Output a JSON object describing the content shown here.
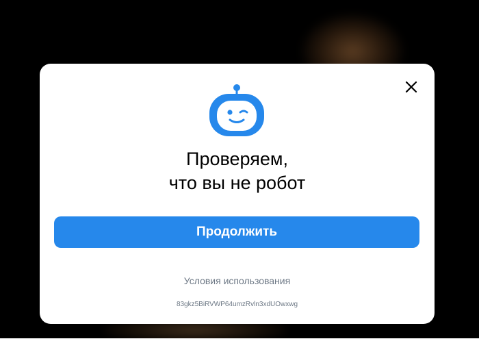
{
  "dialog": {
    "title_line1": "Проверяем,",
    "title_line2": "что вы не робот",
    "continue_label": "Продолжить",
    "terms_label": "Условия использования",
    "token": "83gkz5BiRVWP64umzRvln3xdUOwxwg",
    "close_icon": "close-icon",
    "robot_icon": "robot-winking-icon"
  },
  "colors": {
    "accent": "#2688eb",
    "secondary_text": "#6d7885",
    "overlay": "#000000"
  }
}
